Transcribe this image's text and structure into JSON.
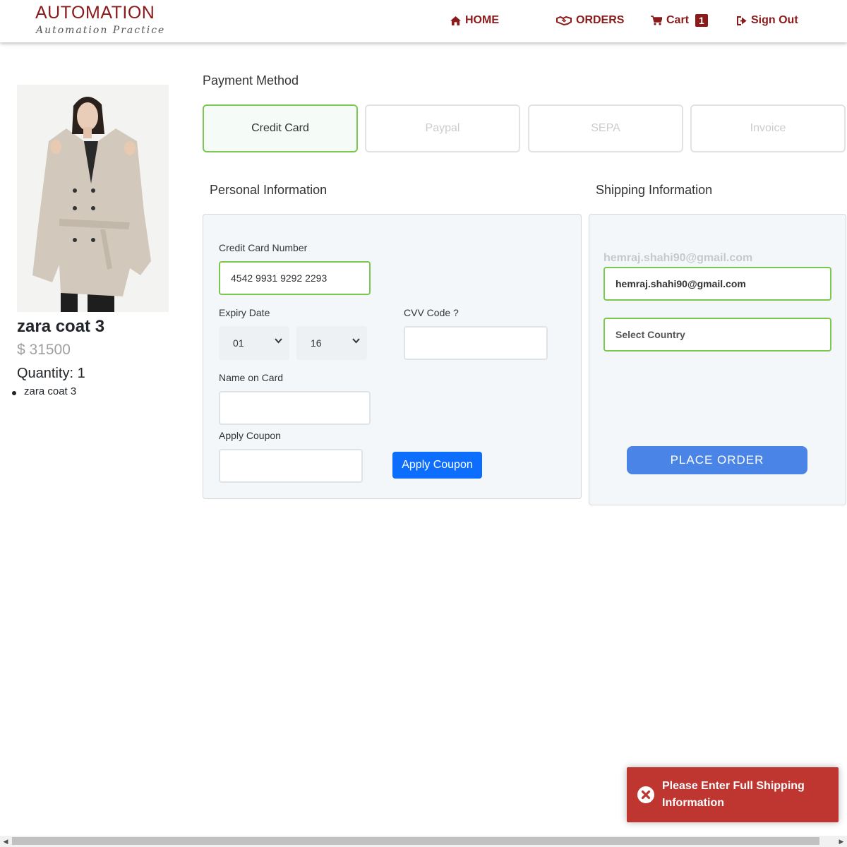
{
  "header": {
    "logo_title": "AUTOMATION",
    "logo_subtitle": "Automation Practice",
    "nav": {
      "home": "HOME",
      "orders": "ORDERS",
      "cart": "Cart",
      "cart_count": "1",
      "sign_out": "Sign Out"
    }
  },
  "product": {
    "name": "zara coat 3",
    "price": "$ 31500",
    "quantity": "Quantity: 1",
    "items": [
      "zara coat 3"
    ]
  },
  "payment": {
    "title": "Payment Method",
    "methods": [
      "Credit Card",
      "Paypal",
      "SEPA",
      "Invoice"
    ],
    "selected": "Credit Card"
  },
  "personal": {
    "title": "Personal Information",
    "card_number_label": "Credit Card Number",
    "card_number_value": "4542 9931 9292 2293",
    "expiry_label": "Expiry Date",
    "expiry_month": "01",
    "expiry_year": "16",
    "cvv_label": "CVV Code ?",
    "name_label": "Name on Card",
    "coupon_label": "Apply Coupon",
    "coupon_button": "Apply Coupon"
  },
  "shipping": {
    "title": "Shipping Information",
    "email_display": "hemraj.shahi90@gmail.com",
    "email_value": "hemraj.shahi90@gmail.com",
    "country_placeholder": "Select Country",
    "place_order": "PLACE ORDER"
  },
  "toast": {
    "message": "Please Enter Full Shipping Information"
  },
  "colors": {
    "brand": "#8b1a1a",
    "active_border": "#7ac84f",
    "coupon_button": "#0d6efd",
    "place_order": "#4a84e6",
    "toast": "#bf3530"
  }
}
